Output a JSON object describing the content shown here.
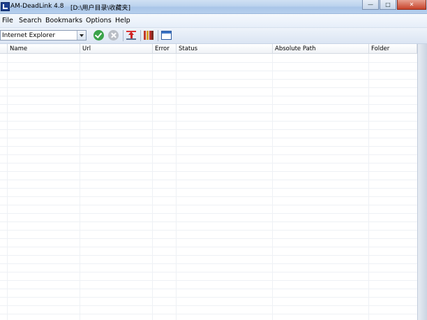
{
  "window": {
    "title": "AM-DeadLink 4.8",
    "path": "[D:\\用户目录\\收藏夹]",
    "min_glyph": "—",
    "max_glyph": "□",
    "close_glyph": "✕"
  },
  "menu": {
    "items": [
      {
        "label": "File"
      },
      {
        "label": "Search"
      },
      {
        "label": "Bookmarks"
      },
      {
        "label": "Options"
      },
      {
        "label": "Help"
      }
    ]
  },
  "toolbar": {
    "browser_select_value": "Internet Explorer",
    "icons": [
      "check-icon",
      "cancel-icon",
      "export-icon",
      "bookmarks-icon",
      "window-icon"
    ]
  },
  "table": {
    "columns": [
      {
        "label": ""
      },
      {
        "label": "Name"
      },
      {
        "label": "Url"
      },
      {
        "label": "Error"
      },
      {
        "label": "Status"
      },
      {
        "label": "Absolute Path"
      },
      {
        "label": "Folder"
      }
    ],
    "rows": []
  }
}
